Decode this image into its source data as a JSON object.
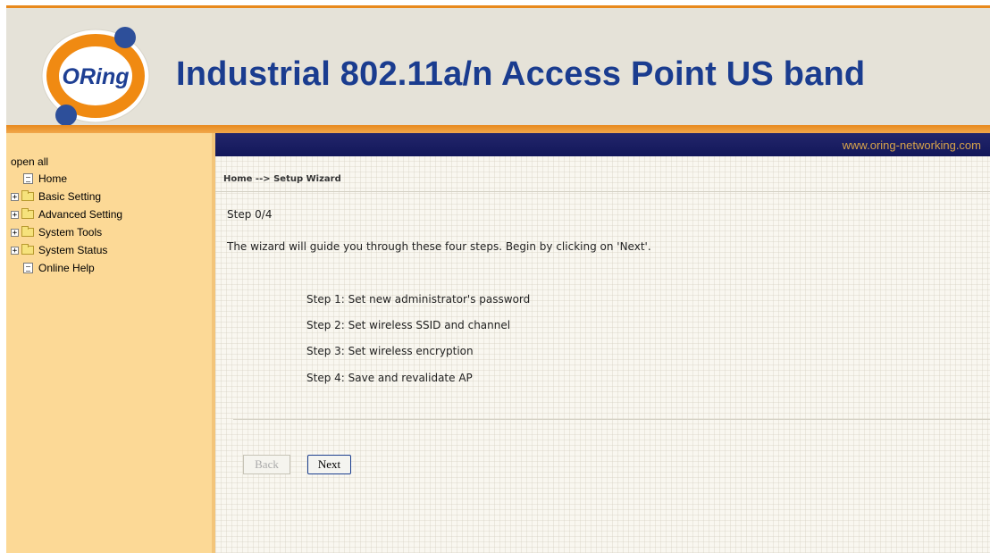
{
  "header": {
    "brand_logo_text": "ORing",
    "title": "Industrial 802.11a/n Access Point US band",
    "url": "www.oring-networking.com"
  },
  "sidebar": {
    "open_all": "open all",
    "items": [
      {
        "label": "Home",
        "type": "page"
      },
      {
        "label": "Basic Setting",
        "type": "folder"
      },
      {
        "label": "Advanced Setting",
        "type": "folder"
      },
      {
        "label": "System Tools",
        "type": "folder"
      },
      {
        "label": "System Status",
        "type": "folder"
      },
      {
        "label": "Online Help",
        "type": "page"
      }
    ]
  },
  "main": {
    "breadcrumb": "Home --> Setup Wizard",
    "step_indicator": "Step 0/4",
    "intro": "The wizard will guide you through these four steps. Begin by clicking on 'Next'.",
    "steps": [
      "Step 1: Set new administrator's password",
      "Step 2: Set wireless SSID and channel",
      "Step 3: Set wireless encryption",
      "Step 4: Save and revalidate AP"
    ],
    "buttons": {
      "back": "Back",
      "next": "Next"
    }
  },
  "colors": {
    "title": "#1a3c8f",
    "accent_orange": "#e8891c",
    "sidebar_bg": "#fcd996",
    "topbar_bg": "#1a1f63",
    "url_text": "#d9a44a"
  }
}
